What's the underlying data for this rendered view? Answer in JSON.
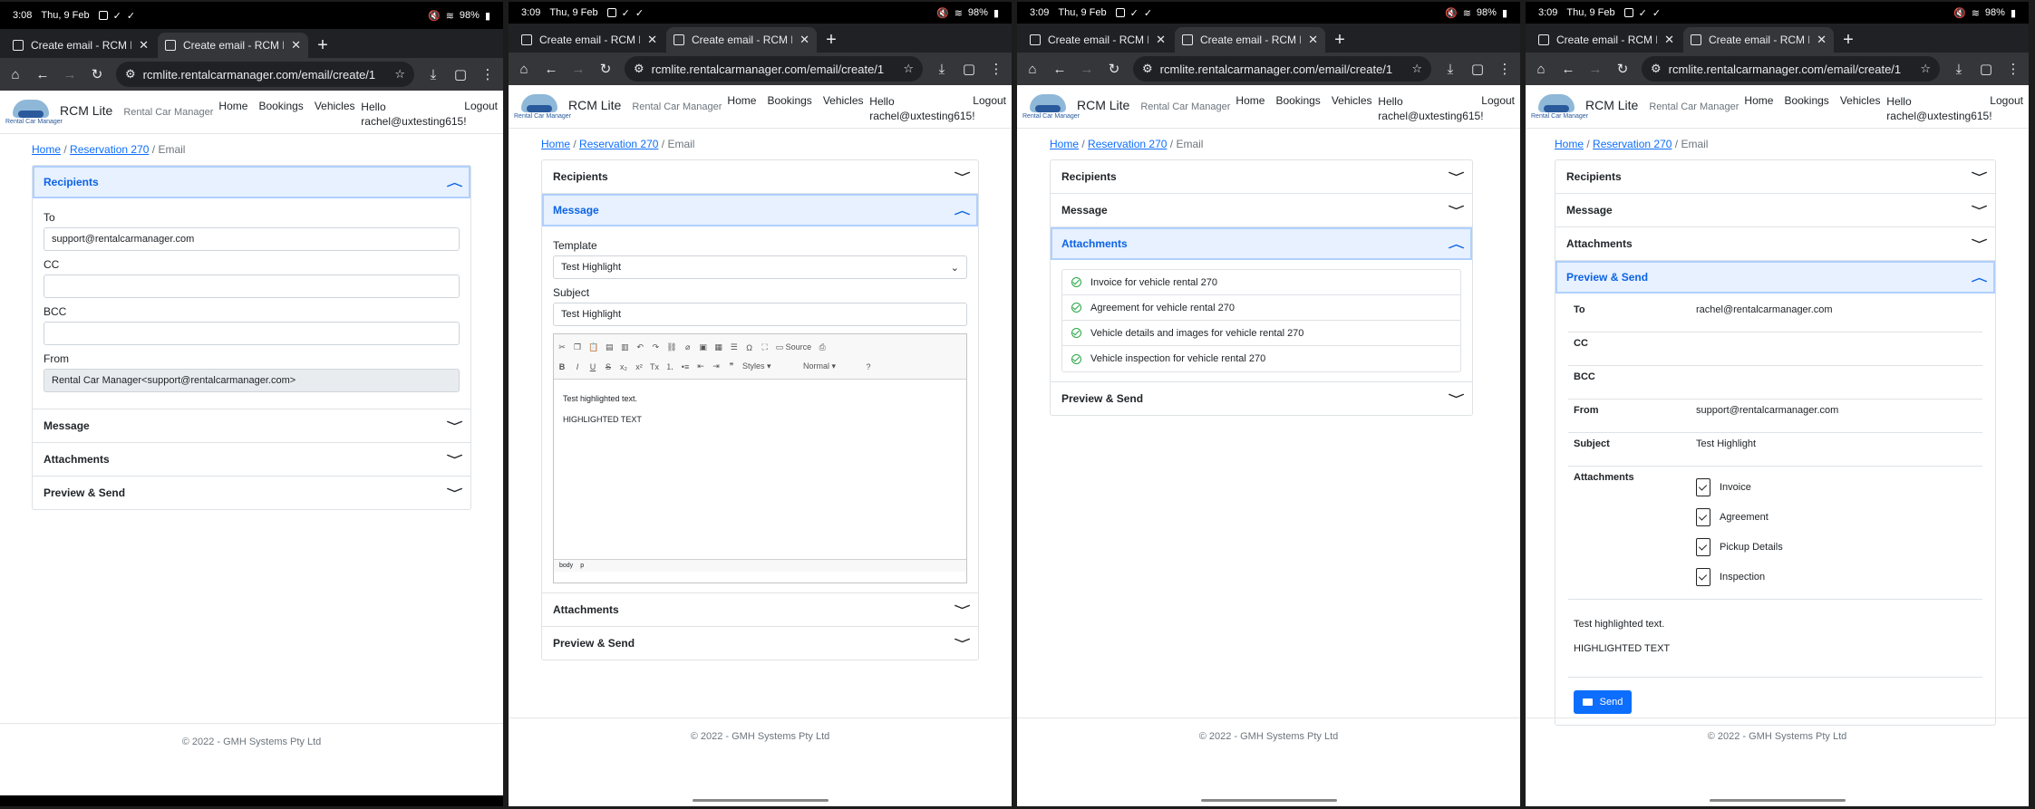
{
  "common": {
    "tab_title": "Create email - RCM Lite",
    "url": "rcmlite.rentalcarmanager.com/email/create/1",
    "brand": "RCM Lite",
    "tagline": "Rental Car Manager",
    "logo_text": "Rental Car Manager",
    "nav": [
      "Home",
      "Bookings",
      "Vehicles"
    ],
    "hello": "Hello",
    "user": "rachel@uxtesting615!",
    "logout": "Logout",
    "crumb_home": "Home",
    "crumb_res": "Reservation 270",
    "crumb_current": "Email",
    "sec_recipients": "Recipients",
    "sec_message": "Message",
    "sec_attachments": "Attachments",
    "sec_preview": "Preview & Send",
    "footer": "© 2022 - GMH Systems Pty Ltd",
    "date": "Thu, 9 Feb",
    "battery": "98%"
  },
  "frame1": {
    "time": "3:08",
    "to_label": "To",
    "to_value": "support@rentalcarmanager.com",
    "cc_label": "CC",
    "bcc_label": "BCC",
    "from_label": "From",
    "from_value": "Rental Car Manager<support@rentalcarmanager.com>"
  },
  "frame2": {
    "time": "3:09",
    "template_label": "Template",
    "template_value": "Test Highlight",
    "subject_label": "Subject",
    "subject_value": "Test Highlight",
    "tb_source": "Source",
    "tb_styles": "Styles",
    "tb_format": "Normal",
    "body_line1": "Test highlighted text.",
    "body_line2": "HIGHLIGHTED TEXT",
    "path_body": "body",
    "path_p": "p"
  },
  "frame3": {
    "time": "3:09",
    "attachments": [
      "Invoice for vehicle rental 270",
      "Agreement for vehicle rental 270",
      "Vehicle details and images for vehicle rental 270",
      "Vehicle inspection for vehicle rental 270"
    ]
  },
  "frame4": {
    "time": "3:09",
    "to_label": "To",
    "to_value": "rachel@rentalcarmanager.com",
    "cc_label": "CC",
    "bcc_label": "BCC",
    "from_label": "From",
    "from_value": "support@rentalcarmanager.com",
    "subject_label": "Subject",
    "subject_value": "Test Highlight",
    "att_label": "Attachments",
    "attachments": [
      "Invoice",
      "Agreement",
      "Pickup Details",
      "Inspection"
    ],
    "body_line1": "Test highlighted text.",
    "body_line2": "HIGHLIGHTED TEXT",
    "send": "Send"
  }
}
